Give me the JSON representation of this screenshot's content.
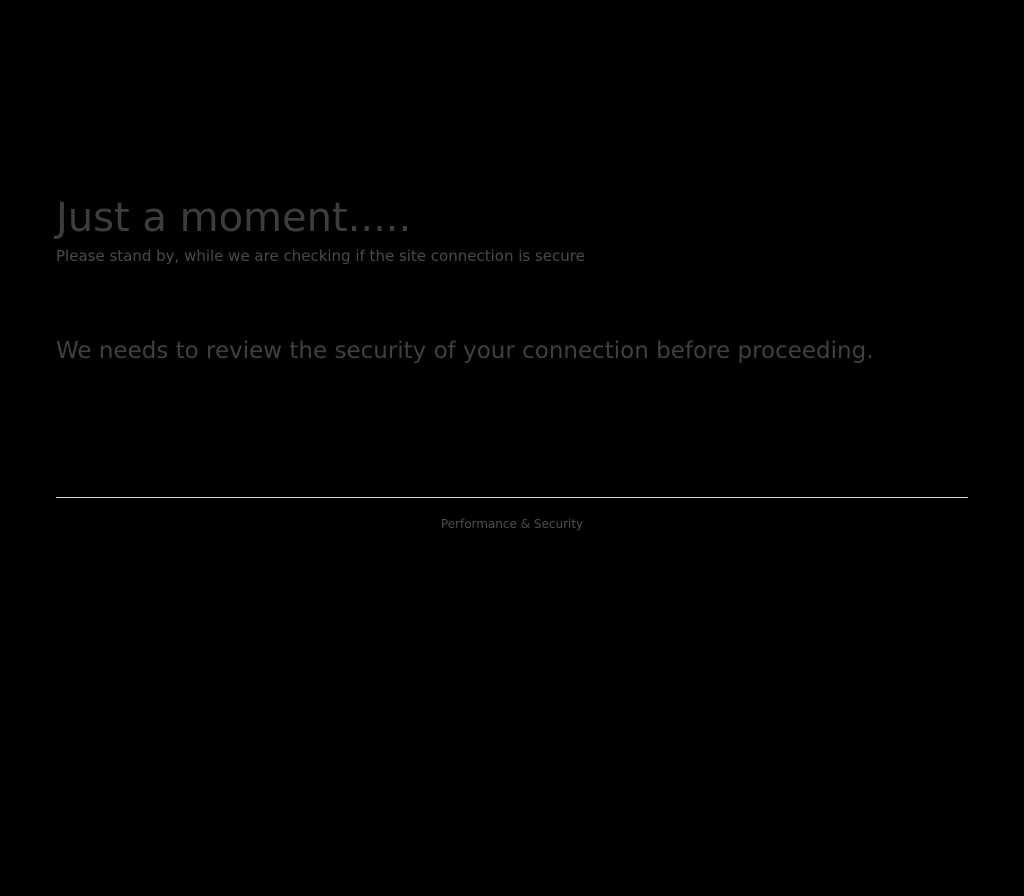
{
  "challenge": {
    "title": "Just a moment.....",
    "subtitle": "Please stand by, while we are checking if the site connection is secure",
    "message": "We needs to review the security of your connection before proceeding."
  },
  "footer": {
    "text": "Performance & Security"
  }
}
